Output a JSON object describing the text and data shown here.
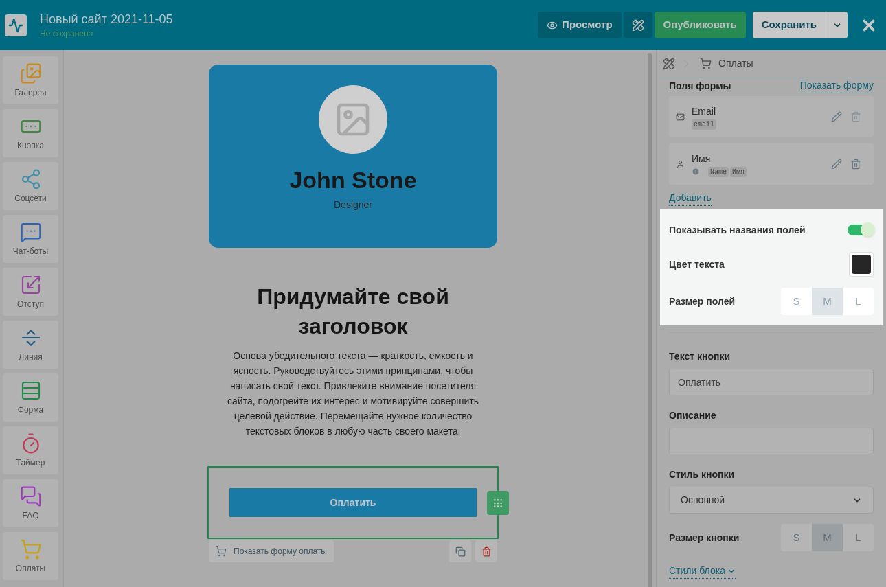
{
  "header": {
    "title": "Новый сайт 2021-11-05",
    "status": "Не сохранено",
    "preview": "Просмотр",
    "publish": "Опубликовать",
    "save": "Сохранить"
  },
  "sidebar": {
    "items": [
      {
        "kind": "gallery",
        "label": "Галерея",
        "color": "#c98a1e"
      },
      {
        "kind": "button",
        "label": "Кнопка",
        "color": "#3f8a3f"
      },
      {
        "kind": "social",
        "label": "Соцсети",
        "color": "#3f8fa8"
      },
      {
        "kind": "chat",
        "label": "Чат-боты",
        "color": "#2a63b8"
      },
      {
        "kind": "spacing",
        "label": "Отступ",
        "color": "#94489a"
      },
      {
        "kind": "line",
        "label": "Линия",
        "color": "#1f5a82"
      },
      {
        "kind": "form",
        "label": "Форма",
        "color": "#1f8a45"
      },
      {
        "kind": "timer",
        "label": "Таймер",
        "color": "#c23a5a"
      },
      {
        "kind": "faq",
        "label": "FAQ",
        "color": "#9a3ab8"
      },
      {
        "kind": "payments",
        "label": "Оплаты",
        "color": "#c9a012"
      }
    ]
  },
  "canvas": {
    "profile": {
      "name": "John Stone",
      "role": "Designer"
    },
    "heading": "Придумайте свой заголовок",
    "body": "Основа убедительного текста — краткость, емкость и ясность. Руководствуйтесь этими принципами, чтобы написать свой текст. Привлеките внимание посетителя сайта, подогрейте их интерес и мотивируйте совершить целевой действие. Перемещайте нужное количество текстовых блоков в любую часть своего макета.",
    "pay_button": "Оплатить",
    "show_form": "Показать форму оплаты"
  },
  "panel": {
    "breadcrumb": "Оплаты",
    "fields_title": "Поля формы",
    "show_form_link": "Показать форму",
    "fields": [
      {
        "kind": "email",
        "label": "Email",
        "warning": false,
        "tags": [
          "email"
        ]
      },
      {
        "kind": "person",
        "label": "Имя",
        "warning": true,
        "tags": [
          "Name",
          "Имя"
        ]
      }
    ],
    "add_link": "Добавить",
    "show_labels": {
      "label": "Показывать названия полей",
      "on": true
    },
    "text_color": {
      "label": "Цвет текста",
      "color": "#262626"
    },
    "field_size": {
      "label": "Размер полей",
      "options": [
        {
          "label": "S",
          "selected": false
        },
        {
          "label": "M",
          "selected": true
        },
        {
          "label": "L",
          "selected": false
        }
      ]
    },
    "button_text": {
      "label": "Текст кнопки",
      "value": "Оплатить"
    },
    "description": {
      "label": "Описание"
    },
    "button_style": {
      "label": "Стиль кнопки",
      "value": "Основной"
    },
    "button_size": {
      "label": "Размер кнопки",
      "options": [
        {
          "label": "S",
          "selected": false
        },
        {
          "label": "M",
          "selected": true
        },
        {
          "label": "L",
          "selected": false
        }
      ]
    },
    "block_styles": "Стили блока"
  }
}
